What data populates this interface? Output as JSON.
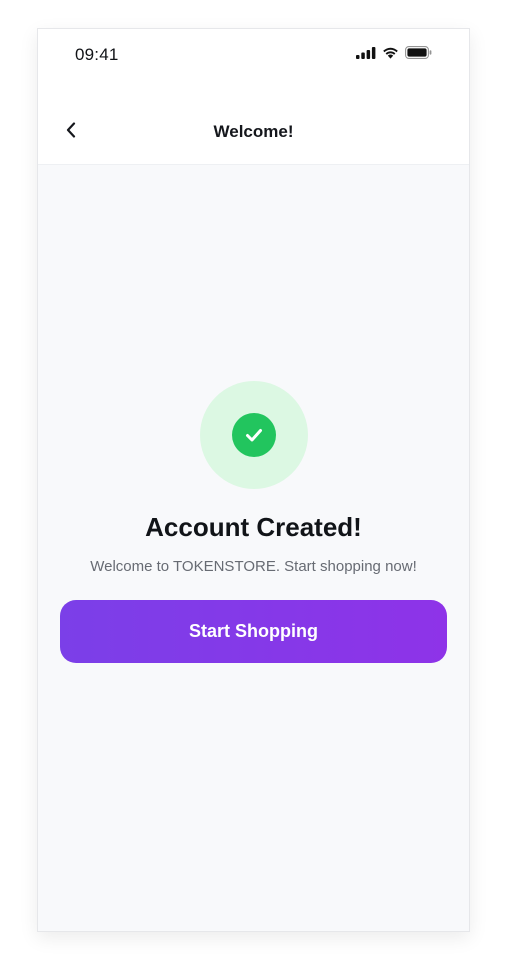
{
  "status_bar": {
    "time": "09:41",
    "icons": [
      "signal-icon",
      "wifi-icon",
      "battery-icon"
    ]
  },
  "nav": {
    "back_icon": "chevron-left-icon",
    "title": "Welcome!"
  },
  "success": {
    "icon": "check-circle-icon",
    "headline": "Account Created!",
    "message": "Welcome to TOKENSTORE. Start shopping now!"
  },
  "cta": {
    "label": "Start Shopping"
  },
  "colors": {
    "accent_start": "#7b3fe8",
    "accent_end": "#8e33e8",
    "success": "#22c55e",
    "success_halo": "#dcf8e3",
    "background": "#f8f9fb"
  }
}
